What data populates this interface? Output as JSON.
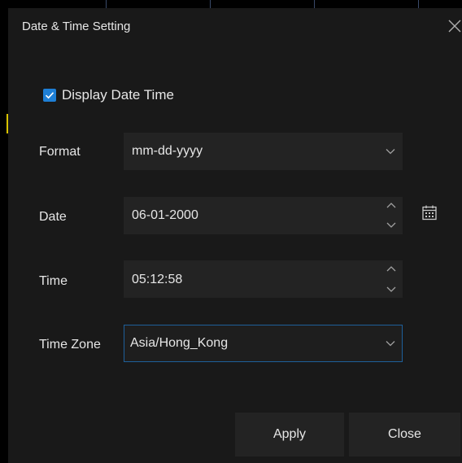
{
  "dialog": {
    "title": "Date & Time Setting",
    "close_icon": "close-icon"
  },
  "display_datetime": {
    "label": "Display Date Time",
    "checked": true
  },
  "format": {
    "label": "Format",
    "value": "mm-dd-yyyy"
  },
  "date": {
    "label": "Date",
    "value": "06-01-2000"
  },
  "time": {
    "label": "Time",
    "value": "05:12:58"
  },
  "timezone": {
    "label": "Time Zone",
    "value": "Asia/Hong_Kong"
  },
  "buttons": {
    "apply": "Apply",
    "close": "Close"
  },
  "colors": {
    "accent": "#1e7fd6",
    "focus_border": "#1e5f9a",
    "panel_bg": "#191919",
    "field_bg": "#232323",
    "text": "#e6e6e6"
  }
}
